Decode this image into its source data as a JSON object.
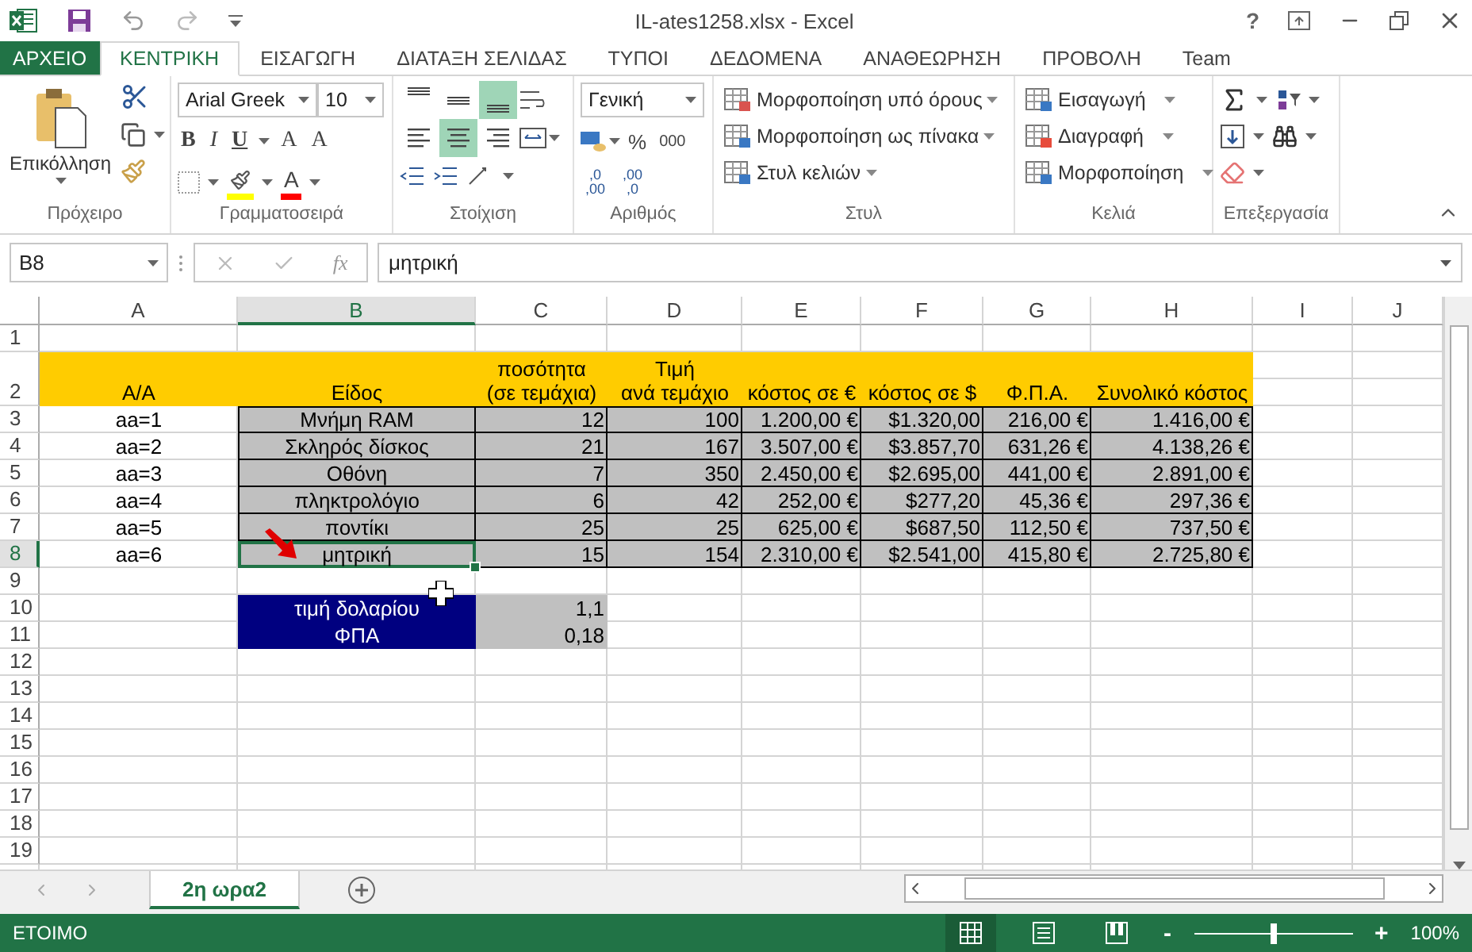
{
  "title_bar": {
    "title": "IL-ates1258.xlsx - Excel",
    "help": "?"
  },
  "tabs": [
    {
      "label": "ΑΡΧΕΙΟ",
      "kind": "file",
      "selected": false
    },
    {
      "label": "ΚΕΝΤΡΙΚΗ",
      "kind": "tab",
      "selected": true
    },
    {
      "label": "ΕΙΣΑΓΩΓΗ",
      "kind": "tab",
      "selected": false
    },
    {
      "label": "ΔΙΑΤΑΞΗ ΣΕΛΙΔΑΣ",
      "kind": "tab",
      "selected": false
    },
    {
      "label": "ΤΥΠΟΙ",
      "kind": "tab",
      "selected": false
    },
    {
      "label": "ΔΕΔΟΜΕΝΑ",
      "kind": "tab",
      "selected": false
    },
    {
      "label": "ΑΝΑΘΕΩΡΗΣΗ",
      "kind": "tab",
      "selected": false
    },
    {
      "label": "ΠΡΟΒΟΛΗ",
      "kind": "tab",
      "selected": false
    },
    {
      "label": "Team",
      "kind": "tab",
      "selected": false
    }
  ],
  "ribbon": {
    "clipboard": {
      "label": "Πρόχειρο",
      "paste": "Επικόλληση"
    },
    "font": {
      "label": "Γραμματοσειρά",
      "name": "Arial Greek",
      "size": "10",
      "bold": "B",
      "italic": "I",
      "underline": "U",
      "grow": "A",
      "shrink": "A",
      "font_color": "A"
    },
    "alignment": {
      "label": "Στοίχιση",
      "vertical": [
        {
          "selected": false
        },
        {
          "selected": false
        },
        {
          "selected": true
        }
      ],
      "horizontal": [
        {
          "selected": false
        },
        {
          "selected": true
        },
        {
          "selected": false
        }
      ]
    },
    "number": {
      "label": "Αριθμός",
      "format": "Γενική",
      "percent": "%",
      "thousands": "000",
      "increase_decimal": [
        ",0",
        ",00"
      ],
      "decrease_decimal": [
        ",00",
        ",0"
      ]
    },
    "styles": {
      "label": "Στυλ",
      "items": [
        "Μορφοποίηση υπό όρους",
        "Μορφοποίηση ως πίνακα",
        "Στυλ κελιών"
      ]
    },
    "cells": {
      "label": "Κελιά",
      "items": [
        "Εισαγωγή",
        "Διαγραφή",
        "Μορφοποίηση"
      ]
    },
    "editing": {
      "label": "Επεξεργασία"
    }
  },
  "formula_bar": {
    "name_box": "B8",
    "fx": "fx",
    "value": "μητρική"
  },
  "sheet": {
    "columns": [
      {
        "label": "A",
        "selected": false
      },
      {
        "label": "B",
        "selected": true
      },
      {
        "label": "C",
        "selected": false
      },
      {
        "label": "D",
        "selected": false
      },
      {
        "label": "E",
        "selected": false
      },
      {
        "label": "F",
        "selected": false
      },
      {
        "label": "G",
        "selected": false
      },
      {
        "label": "H",
        "selected": false
      },
      {
        "label": "I",
        "selected": false
      },
      {
        "label": "J",
        "selected": false
      }
    ],
    "rows": [
      {
        "label": "1",
        "selected": false
      },
      {
        "label": "2",
        "selected": false
      },
      {
        "label": "3",
        "selected": false
      },
      {
        "label": "4",
        "selected": false
      },
      {
        "label": "5",
        "selected": false
      },
      {
        "label": "6",
        "selected": false
      },
      {
        "label": "7",
        "selected": false
      },
      {
        "label": "8",
        "selected": true
      },
      {
        "label": "9",
        "selected": false
      },
      {
        "label": "10",
        "selected": false
      },
      {
        "label": "11",
        "selected": false
      },
      {
        "label": "12",
        "selected": false
      },
      {
        "label": "13",
        "selected": false
      },
      {
        "label": "14",
        "selected": false
      },
      {
        "label": "15",
        "selected": false
      },
      {
        "label": "16",
        "selected": false
      },
      {
        "label": "17",
        "selected": false
      },
      {
        "label": "18",
        "selected": false
      },
      {
        "label": "19",
        "selected": false
      }
    ],
    "headings": [
      "Α/Α",
      "Είδος",
      "ποσότητα\n(σε τεμάχια)",
      "Τιμή\nανά τεμάχιο",
      "κόστος σε €",
      "κόστος σε $",
      "Φ.Π.Α.",
      "Συνολικό κόστος"
    ],
    "data_rows": [
      {
        "aa": "aa=1",
        "item": "Μνήμη RAM",
        "qty": "12",
        "price": "100",
        "cost_eur": "1.200,00 €",
        "cost_usd": "$1.320,00",
        "vat": "216,00 €",
        "total": "1.416,00 €"
      },
      {
        "aa": "aa=2",
        "item": "Σκληρός δίσκος",
        "qty": "21",
        "price": "167",
        "cost_eur": "3.507,00 €",
        "cost_usd": "$3.857,70",
        "vat": "631,26 €",
        "total": "4.138,26 €"
      },
      {
        "aa": "aa=3",
        "item": "Οθόνη",
        "qty": "7",
        "price": "350",
        "cost_eur": "2.450,00 €",
        "cost_usd": "$2.695,00",
        "vat": "441,00 €",
        "total": "2.891,00 €"
      },
      {
        "aa": "aa=4",
        "item": "πληκτρολόγιο",
        "qty": "6",
        "price": "42",
        "cost_eur": "252,00 €",
        "cost_usd": "$277,20",
        "vat": "45,36 €",
        "total": "297,36 €"
      },
      {
        "aa": "aa=5",
        "item": "ποντίκι",
        "qty": "25",
        "price": "25",
        "cost_eur": "625,00 €",
        "cost_usd": "$687,50",
        "vat": "112,50 €",
        "total": "737,50 €"
      },
      {
        "aa": "aa=6",
        "item": "μητρική",
        "qty": "15",
        "price": "154",
        "cost_eur": "2.310,00 €",
        "cost_usd": "$2.541,00",
        "vat": "415,80 €",
        "total": "2.725,80 €"
      }
    ],
    "parameters": [
      {
        "label": "τιμή δολαρίου",
        "value": "1,1"
      },
      {
        "label": "ΦΠΑ",
        "value": "0,18"
      }
    ]
  },
  "sheet_tabs": [
    {
      "label": "2η ωρα2",
      "selected": true
    }
  ],
  "status_bar": {
    "status": "ΕΤΟΙΜΟ",
    "zoom_out": "-",
    "zoom_in": "+",
    "zoom": "100%",
    "zoom_level": {
      "level": 0.5
    }
  }
}
